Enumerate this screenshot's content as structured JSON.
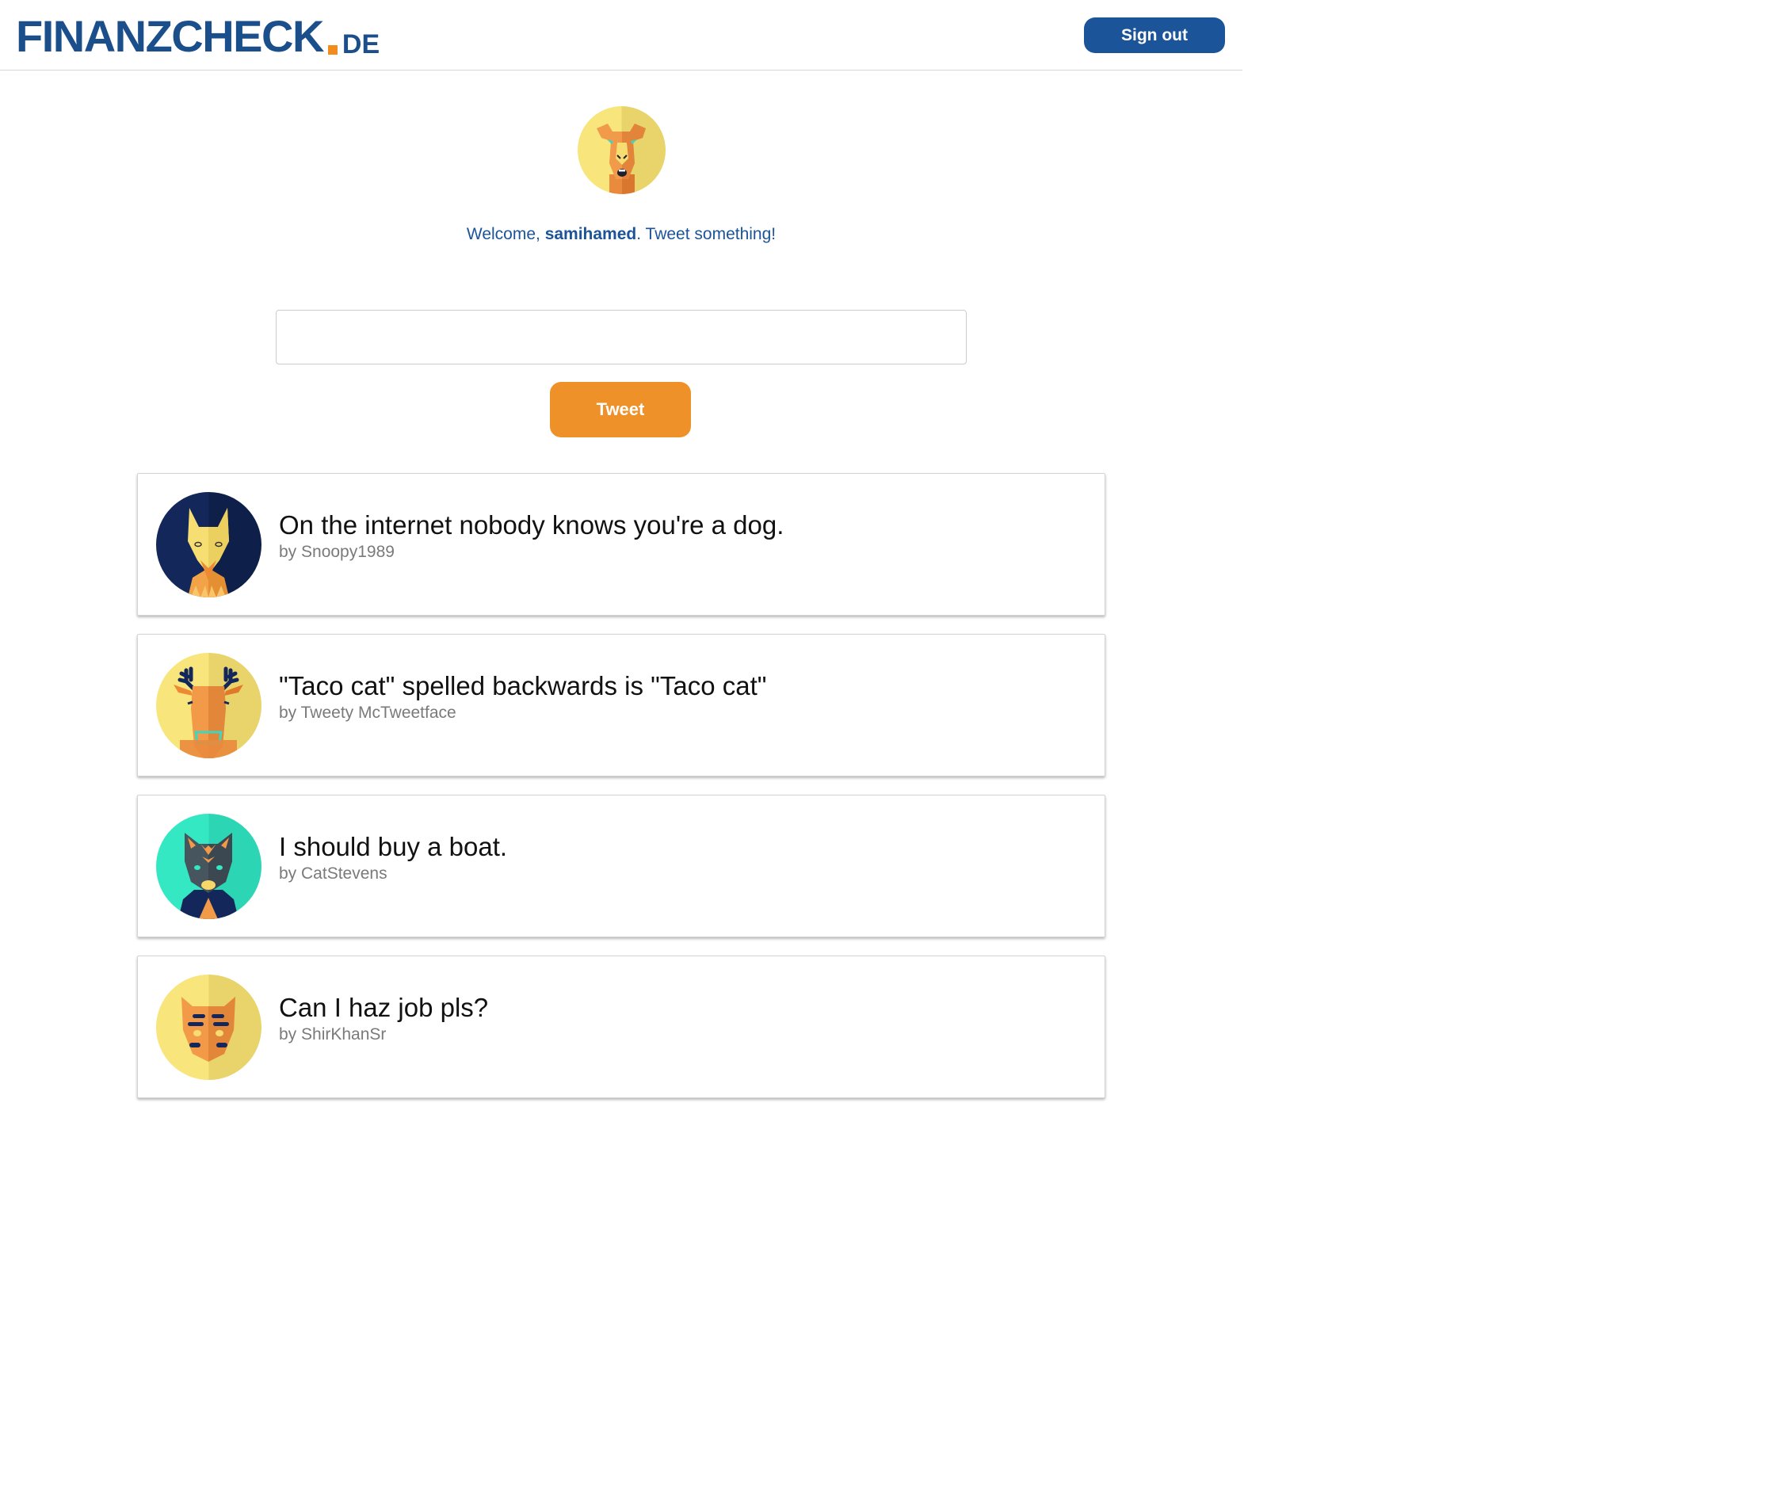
{
  "header": {
    "logo_main": "FINANZCHECK",
    "logo_tld": "DE",
    "signout_label": "Sign out"
  },
  "welcome": {
    "prefix": "Welcome, ",
    "username": "samihamed",
    "suffix": ". Tweet something!"
  },
  "composer": {
    "input_value": "",
    "button_label": "Tweet"
  },
  "tweets": [
    {
      "text": "On the internet nobody knows you're a dog.",
      "author": "by Snoopy1989",
      "avatar_icon": "fox-avatar-icon"
    },
    {
      "text": "\"Taco cat\" spelled backwards is \"Taco cat\"",
      "author": "by Tweety McTweetface",
      "avatar_icon": "moose-avatar-icon"
    },
    {
      "text": "I should buy a boat.",
      "author": "by CatStevens",
      "avatar_icon": "cat-avatar-icon"
    },
    {
      "text": "Can I haz job pls?",
      "author": "by ShirKhanSr",
      "avatar_icon": "tiger-avatar-icon"
    }
  ],
  "colors": {
    "brand_blue": "#1b4f8c",
    "accent_orange": "#ee9128",
    "signout_bg": "#1c5499"
  }
}
